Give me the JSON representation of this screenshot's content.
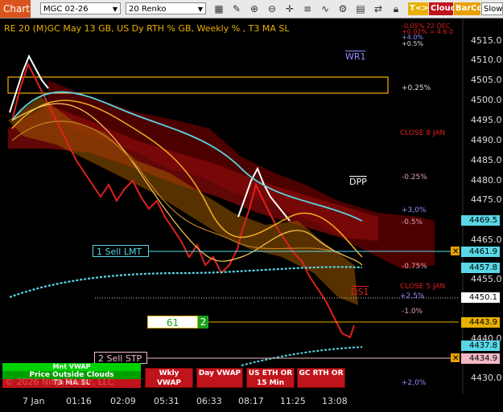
{
  "toolbar": {
    "chart_tab": "Chart",
    "instrument": "MGC 02-26",
    "bar_type": "20 Renko",
    "tok_label": "T<>K",
    "cloud_label": "Cloud",
    "barcol_label": "BarCol",
    "slow_label": "SlowM"
  },
  "chart": {
    "header": "RE 20  (M)GC May 13 GB, US Dy RTH % GB, Weekly % , T3 MA SL",
    "y_ticks": [
      "4515.0",
      "4510.0",
      "4505.0",
      "4500.0",
      "4495.0",
      "4490.0",
      "4485.0",
      "4480.0",
      "4475.0",
      "4465.0",
      "4455.0",
      "4440.0",
      "4430.0"
    ],
    "x_ticks": [
      "7 Jan",
      "01:16",
      "02:09",
      "05:31",
      "06:33",
      "08:17",
      "11:25",
      "13:08"
    ],
    "labels": {
      "wr1": "WR1",
      "dpp": "DPP",
      "ds1": "DS1",
      "close_8jan": "CLOSE 8 JAN",
      "close_5jan": "CLOSE 5 JAN",
      "pct_p025": "+0.25%",
      "pct_m025": "-0.25%",
      "pct_p30": "+3,0%",
      "pct_m05": "-0.5%",
      "pct_m075": "-0.75%",
      "pct_p25": "+2,5%",
      "pct_m10": "-1.0%",
      "pct_p20": "+2,0%",
      "top_red": "-0.05% 22 DEC",
      "top_red2": "+0.02% = 4.6.0",
      "top_p40": "+4.0%",
      "top_p05": "+0.5%"
    },
    "price_boxes": {
      "p4469": "4469.5",
      "p4461": "4461.9",
      "p4457": "4457.8",
      "p4450": "4450.1",
      "p4443": "4443.9",
      "p4437": "4437.8",
      "p4434": "4434.9"
    },
    "orders": {
      "sell_lmt": "1 Sell LMT",
      "sell_stp": "2 Sell STP",
      "position_qty": "61",
      "position_count": "2"
    },
    "buttons": {
      "mnt_vwap": "Mnt VWAP",
      "price_outside": "Price Outside Clouds",
      "t3_ma_sl": "T3 MA SL",
      "wkly_vwap": "Wkly VWAP",
      "day_vwap": "Day VWAP",
      "us_eth": "US ETH OR 15 Min",
      "gc_rth": "GC RTH OR"
    },
    "copyright": "© 2026 NinjaTrader, LLC",
    "colors": {
      "green": "#00d100",
      "red": "#c0141c",
      "orange": "#e8a000",
      "cyan": "#59d7e6",
      "pink": "#f2b8c6"
    }
  }
}
